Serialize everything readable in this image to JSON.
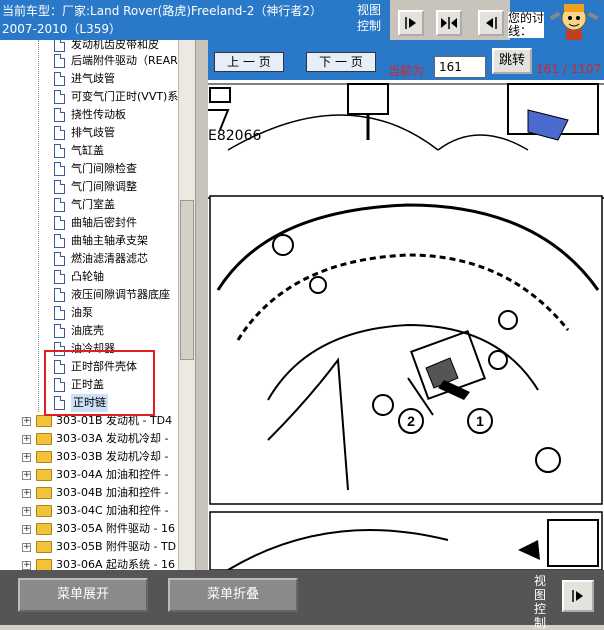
{
  "header": {
    "title_line1": "当前车型：厂家:Land Rover(路虎)Freeland-2（神行者2）",
    "title_line2": "2007-2010（L359）",
    "view_control": "视图控制",
    "hello_text": "您的讨线："
  },
  "tree": {
    "items": [
      {
        "label": "发动机齿皮带和皮",
        "icon": "doc-icon"
      },
      {
        "label": "后端附件驱动（REAR",
        "icon": "doc-icon"
      },
      {
        "label": "进气歧管",
        "icon": "doc-icon"
      },
      {
        "label": "可变气门正时(VVT)系",
        "icon": "doc-icon"
      },
      {
        "label": "挠性传动板",
        "icon": "doc-icon"
      },
      {
        "label": "排气歧管",
        "icon": "doc-icon"
      },
      {
        "label": "气缸盖",
        "icon": "doc-icon"
      },
      {
        "label": "气门间隙检查",
        "icon": "doc-icon"
      },
      {
        "label": "气门间隙调整",
        "icon": "doc-icon"
      },
      {
        "label": "气门室盖",
        "icon": "doc-icon"
      },
      {
        "label": "曲轴后密封件",
        "icon": "doc-icon"
      },
      {
        "label": "曲轴主轴承支架",
        "icon": "doc-icon"
      },
      {
        "label": "燃油滤清器滤芯",
        "icon": "doc-icon"
      },
      {
        "label": "凸轮轴",
        "icon": "doc-icon"
      },
      {
        "label": "液压间隙调节器底座",
        "icon": "doc-icon"
      },
      {
        "label": "油泵",
        "icon": "doc-icon"
      },
      {
        "label": "油底壳",
        "icon": "doc-icon"
      },
      {
        "label": "油冷却器",
        "icon": "doc-icon"
      },
      {
        "label": "正时部件壳体",
        "icon": "doc-icon"
      },
      {
        "label": "正时盖",
        "icon": "doc-icon"
      },
      {
        "label": "正时链",
        "icon": "doc-icon",
        "selected": true
      }
    ],
    "folders": [
      {
        "label": "303-01B 发动机 - TD4"
      },
      {
        "label": "303-03A 发动机冷却 -"
      },
      {
        "label": "303-03B 发动机冷却 -"
      },
      {
        "label": "303-04A 加油和控件 -"
      },
      {
        "label": "303-04B 加油和控件 -"
      },
      {
        "label": "303-04C 加油和控件 -"
      },
      {
        "label": "303-05A 附件驱动 - 16"
      },
      {
        "label": "303-05B 附件驱动 - TD"
      },
      {
        "label": "303-06A 起动系统 - 16"
      }
    ]
  },
  "doc": {
    "prev_label": "上 一 页",
    "next_label": "下 一 页",
    "current_label": "当前为",
    "current_value": "161",
    "jump_label": "跳转",
    "page_count": "161 / 1107",
    "figure_code": "E82066",
    "callout_1": "1",
    "callout_2": "2"
  },
  "bottom": {
    "expand_label": "菜单展开",
    "collapse_label": "菜单折叠",
    "view_control": "视图控制"
  }
}
